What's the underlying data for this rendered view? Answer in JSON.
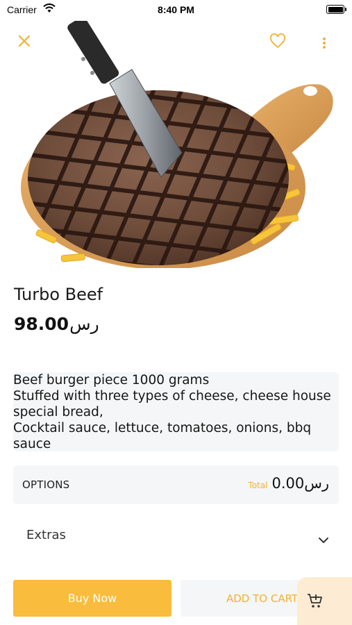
{
  "status_bar": {
    "carrier": "Carrier",
    "time": "8:40 PM"
  },
  "header": {
    "close_icon": "close-icon",
    "favorite_icon": "heart-icon",
    "more_icon": "more-vertical-icon",
    "accent_color": "#f2b230"
  },
  "product": {
    "name": "Turbo Beef",
    "price": "98.00",
    "currency": "رس",
    "image": "steak-on-wooden-board-with-fries",
    "description_lines": [
      "Beef burger piece 1000 grams",
      "Stuffed with three types of cheese, cheese house",
      "special bread,",
      "Cocktail sauce, lettuce, tomatoes, onions, bbq",
      "sauce"
    ]
  },
  "options": {
    "label": "OPTIONS",
    "total_label": "Total",
    "total_value": "0.00",
    "total_currency": "رس"
  },
  "extras": {
    "label": "Extras",
    "icon": "chevron-down-icon"
  },
  "actions": {
    "buy_now": "Buy Now",
    "add_to_cart": "ADD TO CART",
    "cart_icon": "add-to-cart-icon",
    "buy_color": "#f9bc3d",
    "fab_color": "#fdecd3"
  }
}
